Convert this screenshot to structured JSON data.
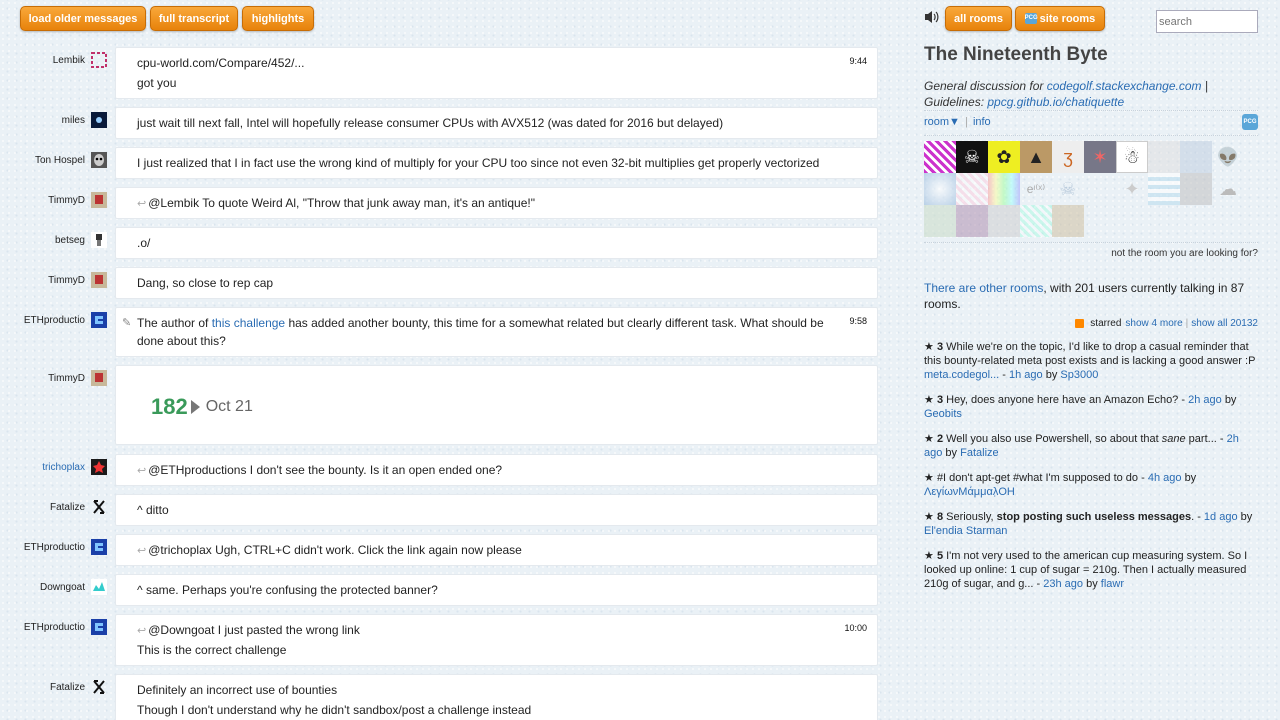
{
  "toolbar": {
    "load_older": "load older messages",
    "full_transcript": "full transcript",
    "highlights": "highlights",
    "all_rooms": "all rooms",
    "site_rooms": "site rooms",
    "site_icon_text": "PCG",
    "search_placeholder": "search"
  },
  "messages": [
    {
      "user": "Lembik",
      "time": "9:44",
      "link": "cpu-world.com/Compare/452/...",
      "text": "got you"
    },
    {
      "user": "miles",
      "text": "just wait till next fall, Intel will hopefully release consumer CPUs with AVX512 (was dated for 2016 but delayed)"
    },
    {
      "user": "Ton Hospel",
      "text": "I just realized that I in fact use the wrong kind of multiply for your CPU too since not even 32-bit multiplies get properly vectorized"
    },
    {
      "user": "TimmyD",
      "text": "@Lembik To quote Weird Al, \"Throw that junk away man, it's an antique!\""
    },
    {
      "user": "betseg",
      "text": ".o/"
    },
    {
      "user": "TimmyD",
      "text": "Dang, so close to rep cap"
    },
    {
      "user": "ETHproductio",
      "time": "9:58",
      "pre": "The author of ",
      "link": "this challenge",
      "post": " has added another bounty, this time for a somewhat related but clearly different task. What should be",
      "line2": "done about this?"
    },
    {
      "user": "TimmyD",
      "rep_value": "182",
      "rep_date": "Oct 21"
    },
    {
      "user": "trichoplax",
      "text": "@ETHproductions I don't see the bounty. Is it an open ended one?"
    },
    {
      "user": "Fatalize",
      "text": "^ ditto"
    },
    {
      "user": "ETHproductio",
      "text": "@trichoplax Ugh, CTRL+C didn't work. Click the link again now please"
    },
    {
      "user": "Downgoat",
      "text": "^ same. Perhaps you're confusing the protected banner?"
    },
    {
      "user": "ETHproductio",
      "time": "10:00",
      "text": "@Downgoat I just pasted the wrong link",
      "link2": "This is the correct challenge"
    },
    {
      "user": "Fatalize",
      "text": "Definitely an incorrect use of bounties",
      "line2": "Though I don't understand why he didn't sandbox/post a challenge instead"
    }
  ],
  "sidebar": {
    "title": "The Nineteenth Byte",
    "desc_pre": "General discussion for ",
    "desc_link1": "codegolf.stackexchange.com",
    "desc_mid": " |",
    "desc_guidelines": "Guidelines: ",
    "desc_link2": "ppcg.github.io/chatiquette",
    "room_menu": "room▼",
    "sep": "|",
    "info": "info",
    "badge": "PCG",
    "not_room": "not the room you are looking for?",
    "other_rooms_link": "There are other rooms",
    "other_rooms_text": ", with 201 users currently talking in 87",
    "other_rooms_text2": "rooms.",
    "starred": "starred",
    "show_more": "show 4 more",
    "show_all": "show all 20132",
    "stars": [
      {
        "count": "3",
        "text": "While we're on the topic, I'd like to drop a casual reminder that",
        "text2": "this bounty-related meta post exists and is lacking a good answer :P",
        "link": "meta.codegol...",
        "ago": "1h ago",
        "by": "by",
        "user": "Sp3000"
      },
      {
        "count": "3",
        "text": "Hey, does anyone here have an Amazon Echo? -",
        "ago": "2h ago",
        "by": "by",
        "user": "Geobits"
      },
      {
        "count": "2",
        "text": "Well you also use Powershell, so about that ",
        "em": "sane",
        "text_after": " part... -",
        "ago": "2h",
        "ago2": "ago",
        "by": "by",
        "user": "Fatalize"
      },
      {
        "count": "",
        "text": "#I don't apt-get #what I'm supposed to do -",
        "ago": "4h ago",
        "by": "by",
        "user": "ΛεγίωνΜάμμαλ̣ΟΗ"
      },
      {
        "count": "8",
        "text": "Seriously, ",
        "strong": "stop posting such useless messages",
        "text_after": ". -",
        "ago": "1d ago",
        "by": "by",
        "user": "El'endia Starman"
      },
      {
        "count": "5",
        "text": "I'm not very used to the american cup measuring system. So I",
        "text2": "looked up online: 1 cup of sugar = 210g. Then I actually measured",
        "text3": "210g of sugar, and g... -",
        "ago": "23h ago",
        "by": "by",
        "user": "flawr"
      }
    ]
  }
}
